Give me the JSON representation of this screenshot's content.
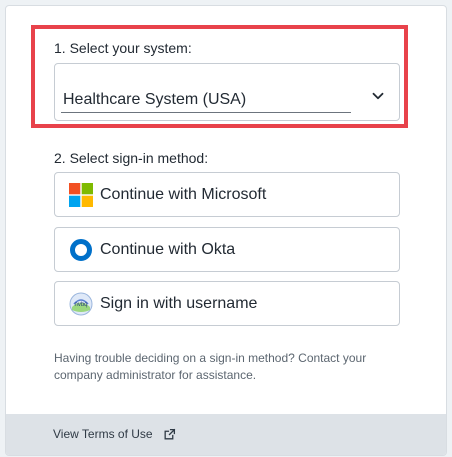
{
  "step1": {
    "label": "1. Select your system:",
    "selected_value": "Healthcare System (USA)"
  },
  "step2": {
    "label": "2. Select sign-in method:",
    "methods": [
      {
        "label": "Continue with Microsoft",
        "icon": "microsoft-logo-icon"
      },
      {
        "label": "Continue with Okta",
        "icon": "okta-logo-icon"
      },
      {
        "label": "Sign in with username",
        "icon": "app-logo-icon"
      }
    ]
  },
  "help_text": "Having trouble deciding on a sign-in method? Contact your company administrator for assistance.",
  "footer": {
    "terms_label": "View Terms of Use",
    "terms_icon": "external-link-icon"
  },
  "colors": {
    "highlight": "#e8424b",
    "okta_blue": "#0070c9",
    "ms_red": "#f25022",
    "ms_green": "#7fba00",
    "ms_blue": "#00a4ef",
    "ms_yellow": "#ffb900"
  }
}
